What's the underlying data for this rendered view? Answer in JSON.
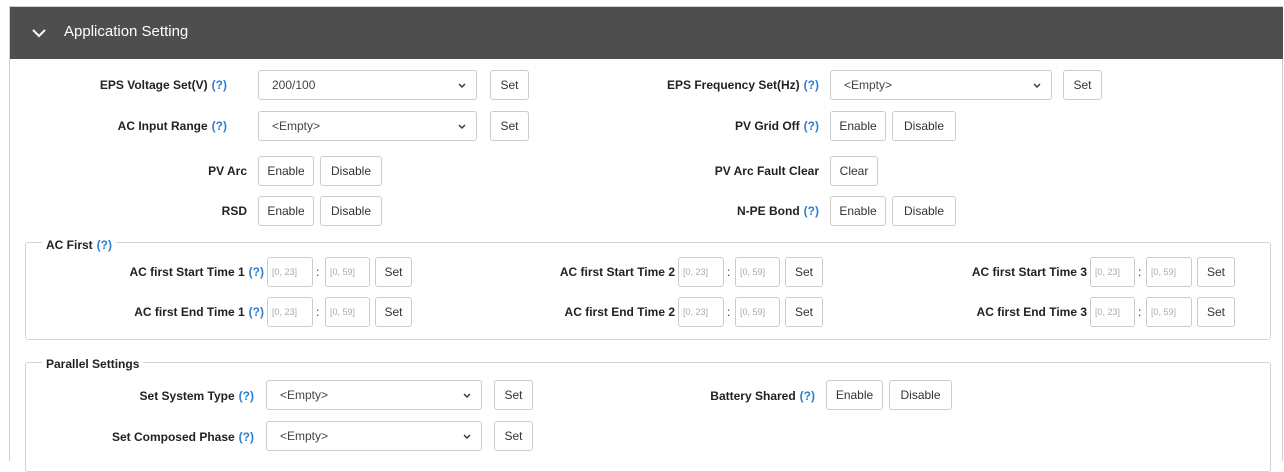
{
  "header": {
    "title": "Application Setting",
    "icon": "chevron-down-icon"
  },
  "help_mark": "(?)",
  "rows": {
    "eps_voltage": {
      "label": "EPS Voltage Set(V)",
      "value": "200/100",
      "set": "Set"
    },
    "eps_frequency": {
      "label": "EPS Frequency Set(Hz)",
      "value": "<Empty>",
      "set": "Set"
    },
    "ac_input_range": {
      "label": "AC Input Range",
      "value": "<Empty>",
      "set": "Set"
    },
    "pv_grid_off": {
      "label": "PV Grid Off",
      "enable": "Enable",
      "disable": "Disable"
    },
    "pv_arc": {
      "label": "PV Arc",
      "enable": "Enable",
      "disable": "Disable"
    },
    "pv_arc_fault_clear": {
      "label": "PV Arc Fault Clear",
      "clear": "Clear"
    },
    "rsd": {
      "label": "RSD",
      "enable": "Enable",
      "disable": "Disable"
    },
    "npe_bond": {
      "label": "N-PE Bond",
      "enable": "Enable",
      "disable": "Disable"
    }
  },
  "ac_first": {
    "legend": "AC First",
    "hour_placeholder": "[0, 23]",
    "minute_placeholder": "[0, 59]",
    "colon": ":",
    "set": "Set",
    "start1": "AC first Start Time 1",
    "start2": "AC first Start Time 2",
    "start3": "AC first Start Time 3",
    "end1": "AC first End Time 1",
    "end2": "AC first End Time 2",
    "end3": "AC first End Time 3"
  },
  "parallel": {
    "legend": "Parallel Settings",
    "system_type": {
      "label": "Set System Type",
      "value": "<Empty>",
      "set": "Set"
    },
    "battery_shared": {
      "label": "Battery Shared",
      "enable": "Enable",
      "disable": "Disable"
    },
    "composed_phase": {
      "label": "Set Composed Phase",
      "value": "<Empty>",
      "set": "Set"
    }
  },
  "colors": {
    "header_bg": "#4e4e4e",
    "help_link": "#2d7dd2"
  }
}
